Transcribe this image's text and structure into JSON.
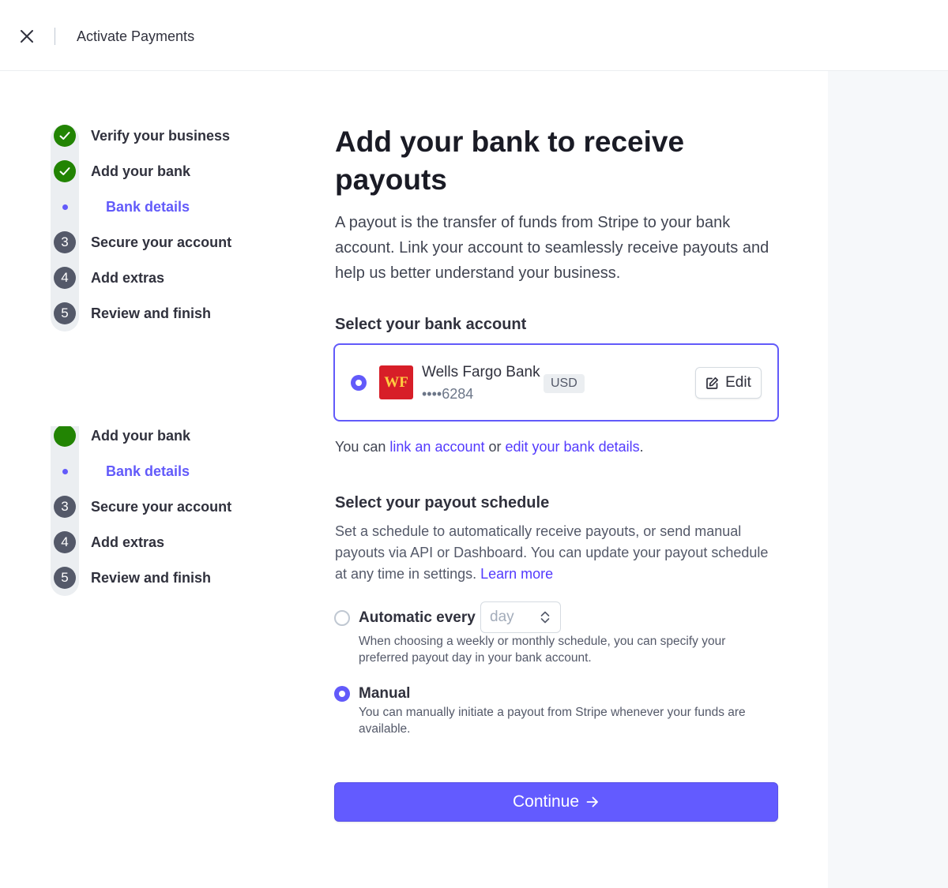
{
  "header": {
    "title": "Activate Payments",
    "close_icon": "close-icon"
  },
  "steps": [
    {
      "label": "Verify your business",
      "state": "done"
    },
    {
      "label": "Add your bank",
      "state": "done"
    },
    {
      "label": "Bank details",
      "state": "current-sub"
    },
    {
      "label": "Secure your account",
      "state": "pending",
      "number": "3"
    },
    {
      "label": "Add extras",
      "state": "pending",
      "number": "4"
    },
    {
      "label": "Review and finish",
      "state": "pending",
      "number": "5"
    }
  ],
  "main": {
    "title": "Add your bank to receive payouts",
    "intro": "A payout is the transfer of funds from Stripe to your bank account. Link your account to seamlessly receive payouts and help us better understand your business."
  },
  "bank_section": {
    "title": "Select your bank account",
    "account": {
      "logo_text": "WF",
      "name": "Wells Fargo Bank",
      "masked_number": "••••6284",
      "currency": "USD",
      "edit_label": "Edit",
      "selected": true
    },
    "link_line": {
      "prefix": "You can ",
      "link_account": "link an account",
      "middle": " or ",
      "edit_details": "edit your bank details",
      "suffix": "."
    }
  },
  "payout_section": {
    "title": "Select your payout schedule",
    "description": "Set a schedule to automatically receive payouts, or send manual payouts via API or Dashboard. You can update your payout schedule at any time in settings.",
    "learn_more": "Learn more",
    "options": {
      "automatic": {
        "label": "Automatic every",
        "select_value": "day",
        "help": "When choosing a weekly or monthly schedule, you can specify your preferred payout day in your bank account.",
        "selected": false
      },
      "manual": {
        "label": "Manual",
        "help": "You can manually initiate a payout from Stripe whenever your funds are available.",
        "selected": true
      }
    }
  },
  "actions": {
    "continue_label": "Continue"
  },
  "colors": {
    "accent": "#635bff",
    "success": "#228403",
    "link": "#533afd"
  }
}
